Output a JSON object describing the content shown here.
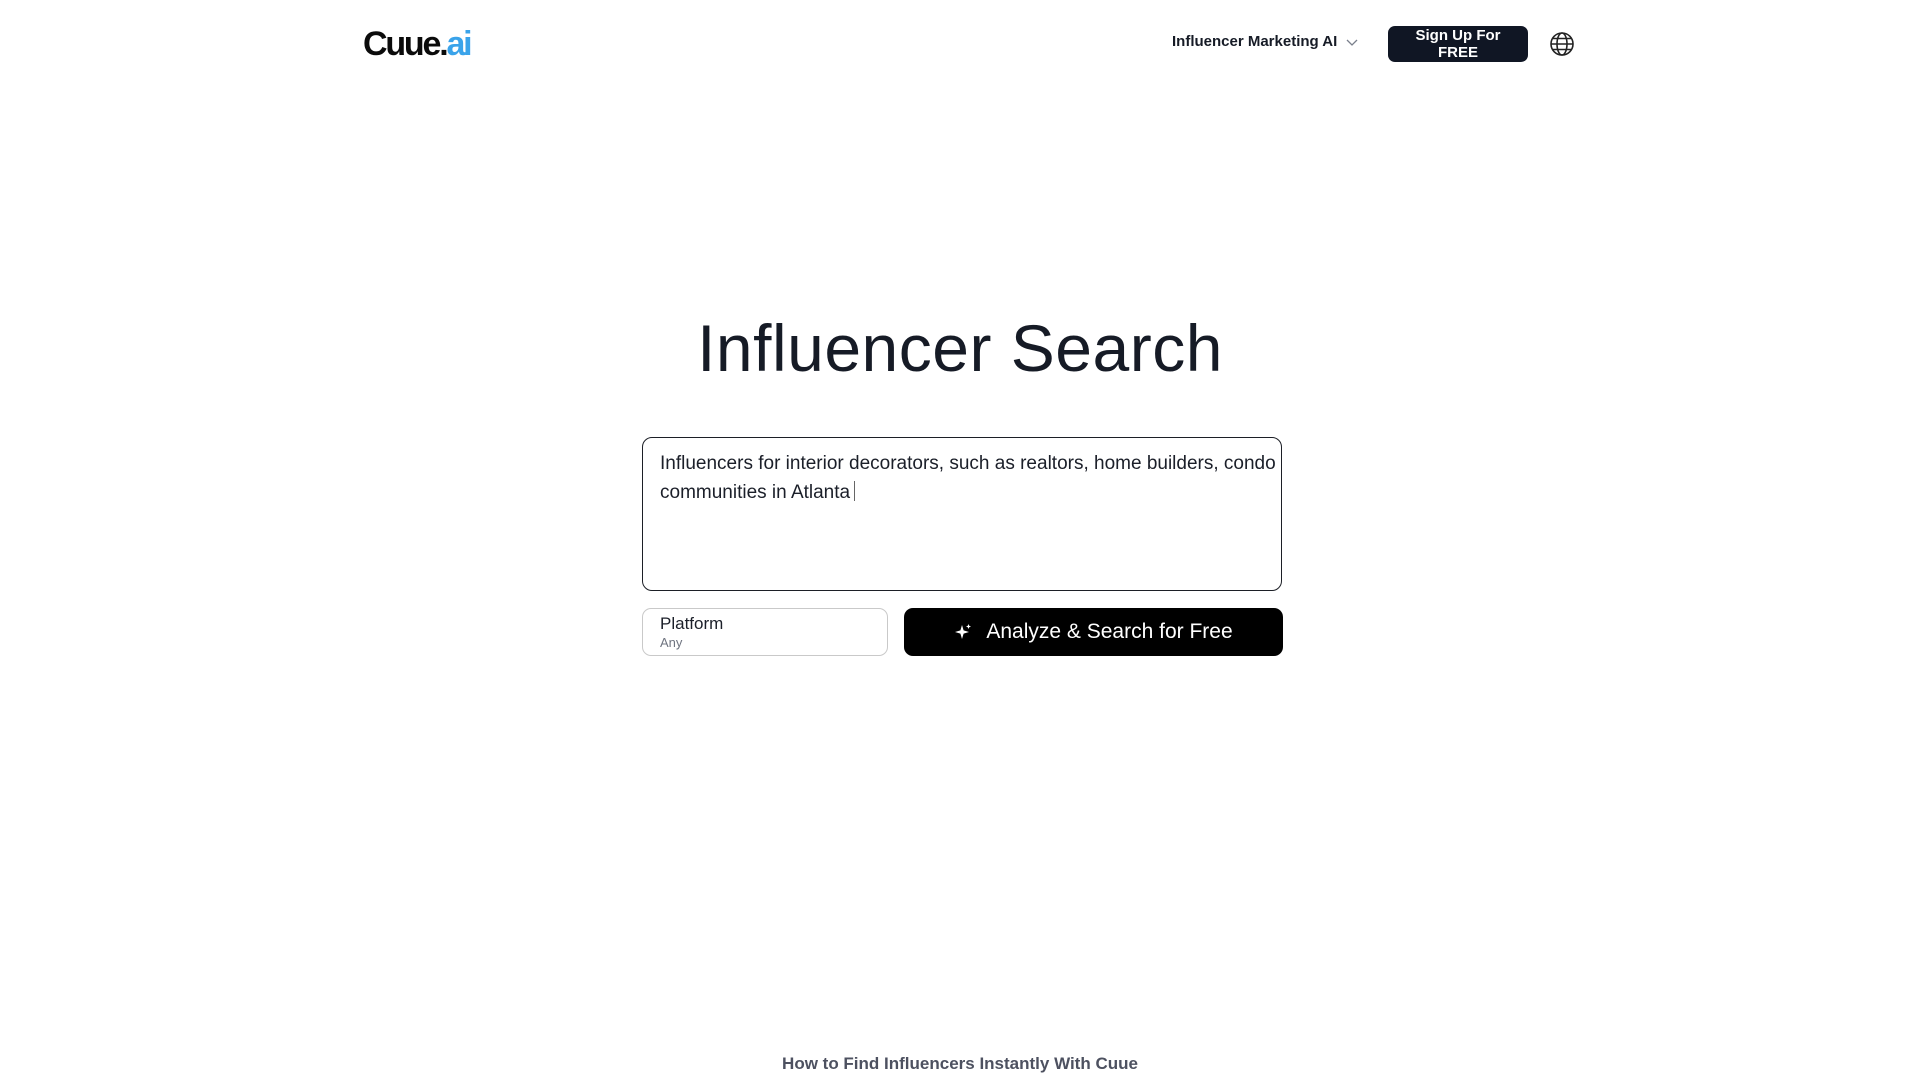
{
  "header": {
    "logo": {
      "text_main": "Cuue",
      "text_dot": ".",
      "text_ai": "ai"
    },
    "nav_menu_label": "Influencer Marketing AI",
    "signup_label": "Sign Up For FREE"
  },
  "hero": {
    "title": "Influencer Search",
    "query": "Influencers for interior decorators, such as realtors, home builders, condo communities in Atlanta",
    "platform": {
      "label": "Platform",
      "value": "Any"
    },
    "analyze_label": "Analyze & Search for Free"
  },
  "footer_heading": "How to Find Influencers Instantly With Cuue",
  "colors": {
    "brand_accent": "#3aa3ea",
    "primary_button": "#101624",
    "analyze_button": "#000000"
  },
  "icons": [
    "chevron-down-icon",
    "globe-icon",
    "sparkle-icon"
  ]
}
